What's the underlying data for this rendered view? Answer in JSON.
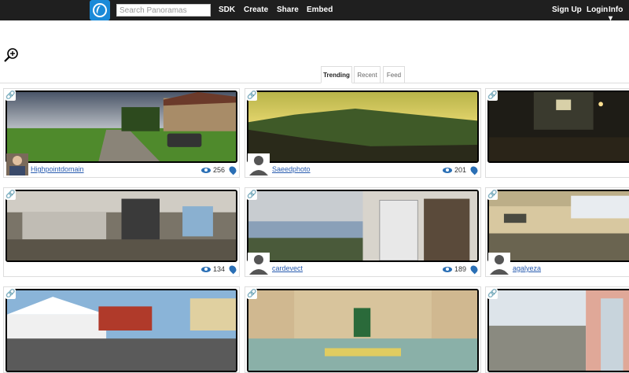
{
  "header": {
    "search_placeholder": "Search Panoramas",
    "nav": [
      "SDK",
      "Create",
      "Share",
      "Embed"
    ],
    "right_nav": [
      "Sign Up",
      "Login",
      "Info"
    ],
    "info_caret": "▾"
  },
  "tabs": [
    "Trending",
    "Recent",
    "Feed"
  ],
  "active_tab": "Trending",
  "icons": {
    "link": "link-icon",
    "zoom": "zoom-in-icon",
    "views": "eye-icon",
    "location": "map-pin-icon"
  },
  "cards": [
    {
      "user": "Highpointdomain",
      "views": "256",
      "has_photo_avatar": true
    },
    {
      "user": "Saeedphoto",
      "views": "201"
    },
    {
      "user": "",
      "views": ""
    },
    {
      "user": "",
      "views": "134"
    },
    {
      "user": "cardevect",
      "views": "189"
    },
    {
      "user": "agalyeza",
      "views": ""
    },
    {
      "user": "",
      "views": ""
    },
    {
      "user": "",
      "views": ""
    },
    {
      "user": "",
      "views": ""
    }
  ],
  "colors": {
    "topbar": "#1f1f1f",
    "logo": "#1a8ad8",
    "link": "#2a5db0",
    "icon_blue": "#2a6fb5"
  }
}
